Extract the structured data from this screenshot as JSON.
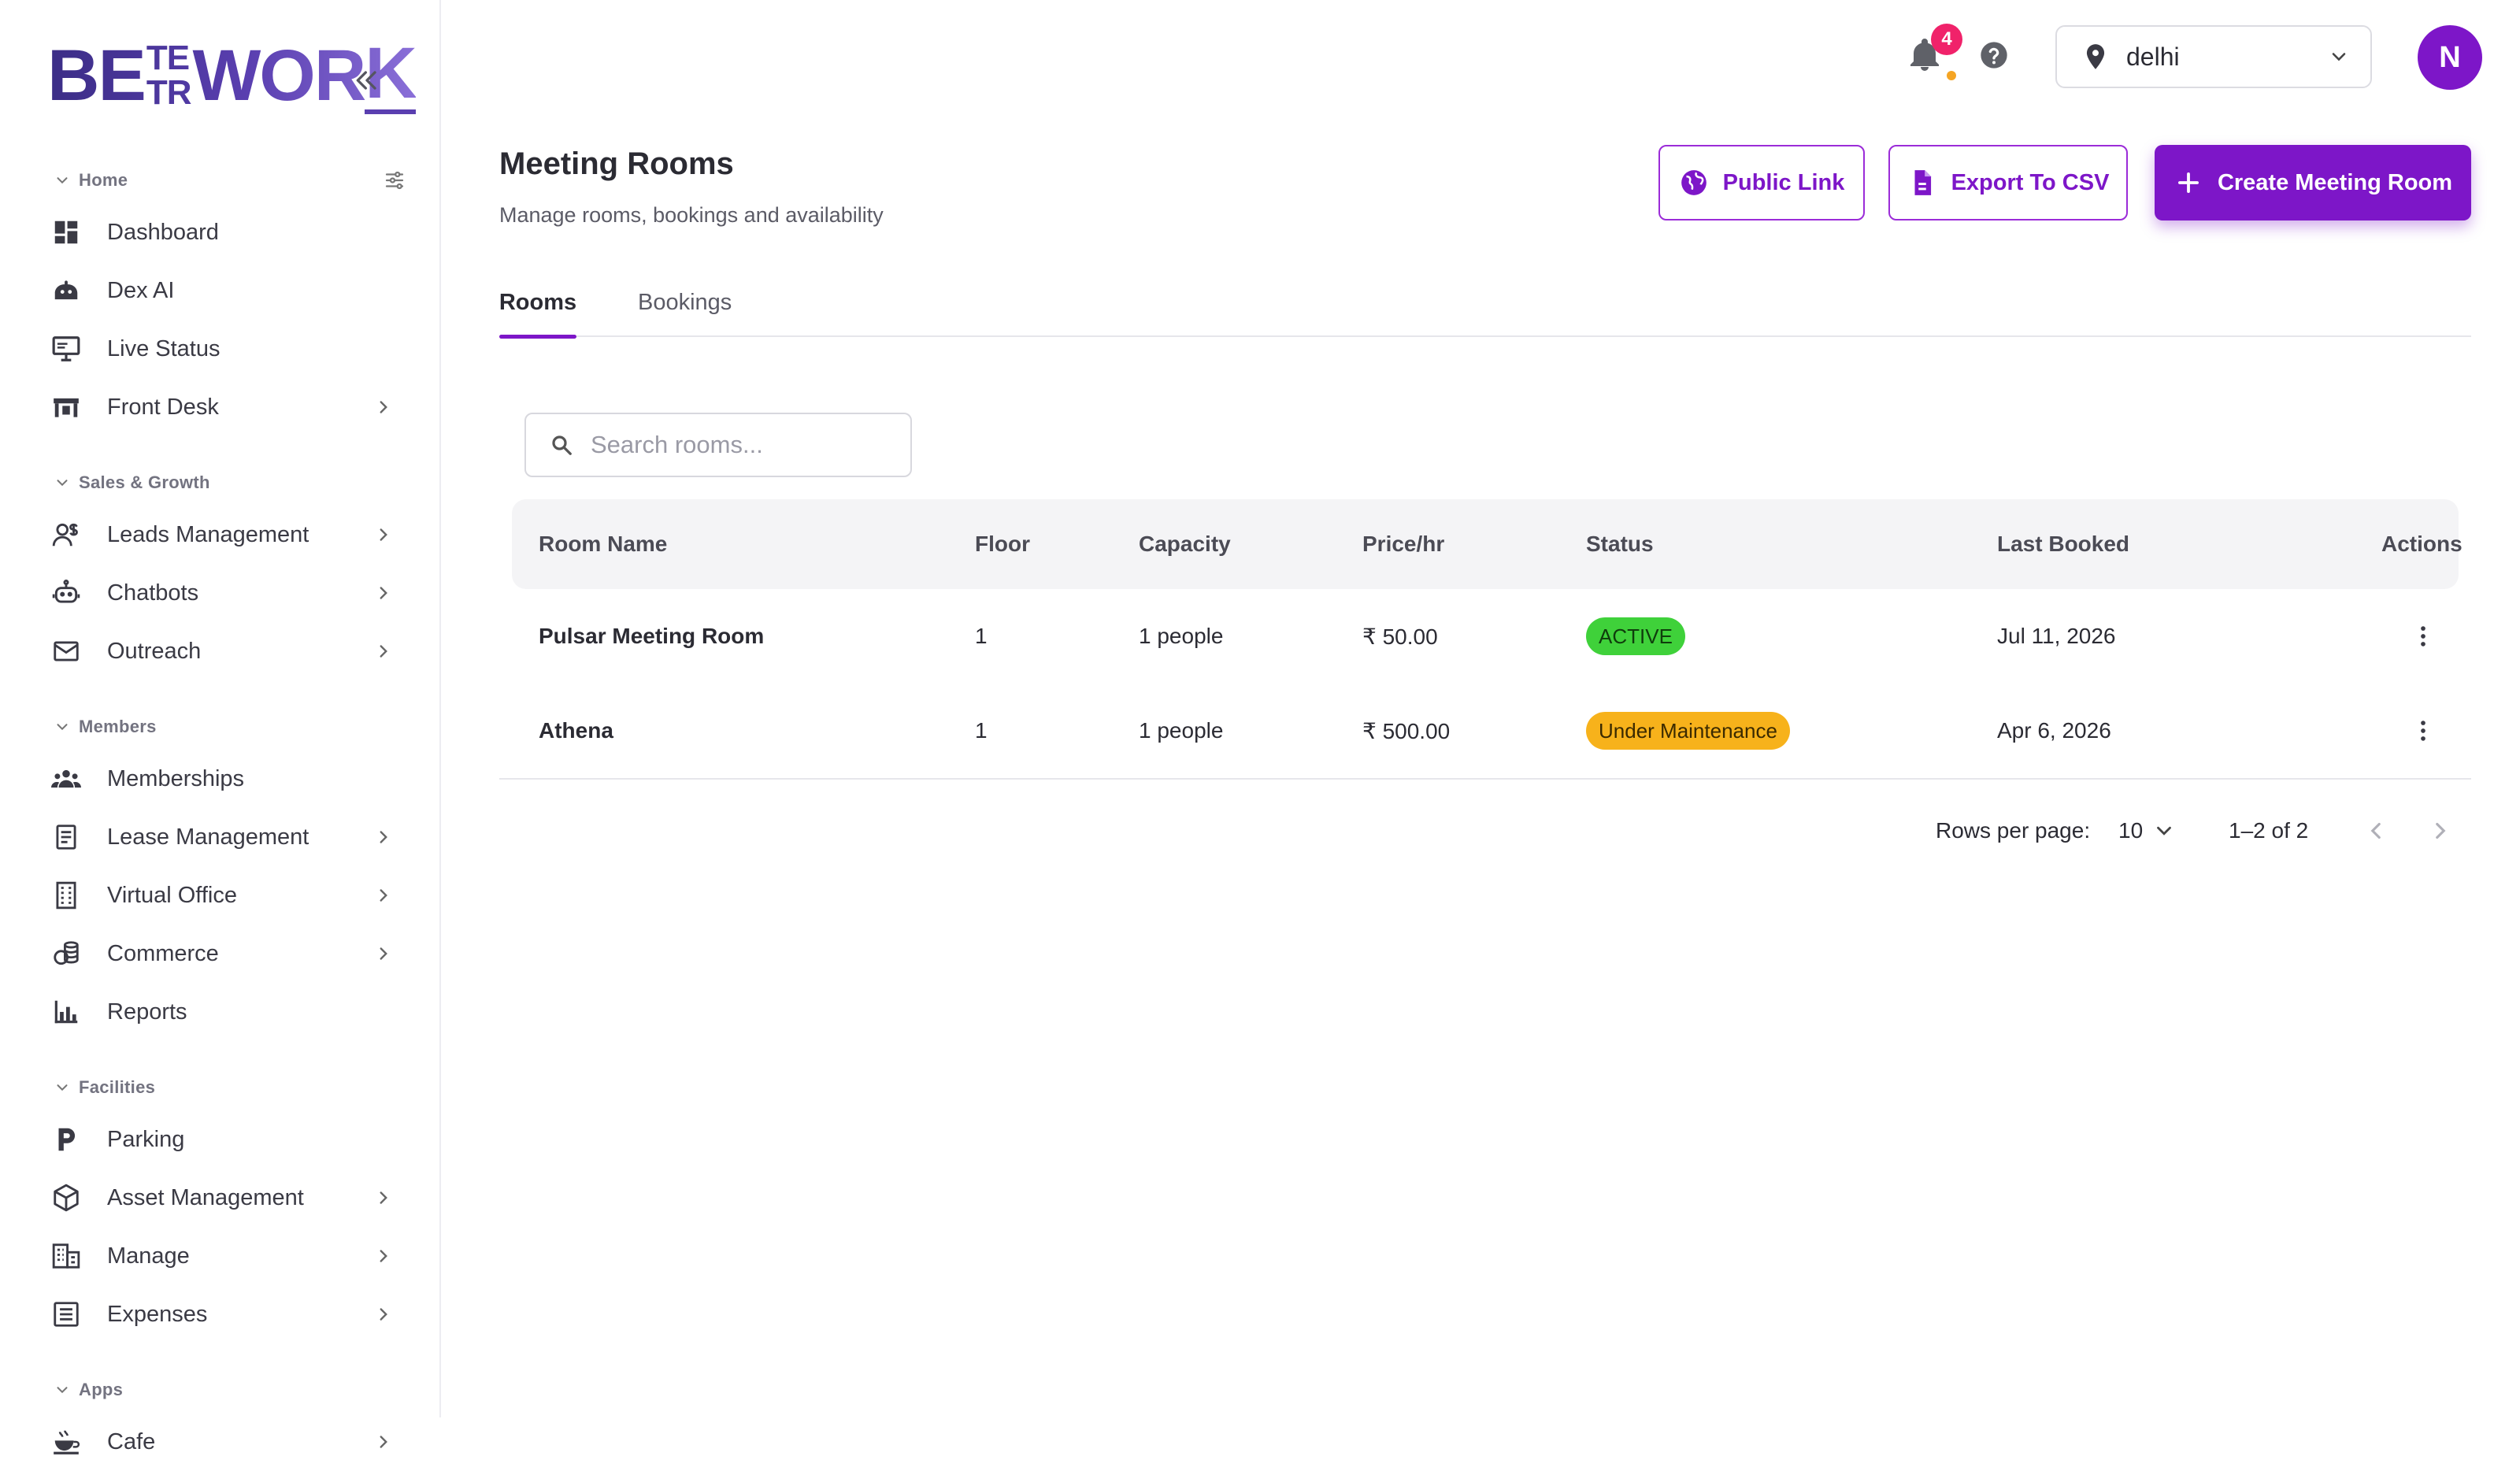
{
  "brand": {
    "logo_top": "BE",
    "logo_mid_a": "TE",
    "logo_mid_b": "TR",
    "logo_end": "WOR",
    "logo_last": "K"
  },
  "sidebar": {
    "sections": [
      {
        "title": "Home",
        "items": [
          {
            "label": "Dashboard",
            "icon": "dashboard-icon"
          },
          {
            "label": "Dex AI",
            "icon": "robot-icon"
          },
          {
            "label": "Live Status",
            "icon": "monitor-icon"
          },
          {
            "label": "Front Desk",
            "icon": "front-desk-icon",
            "has_children": true
          }
        ]
      },
      {
        "title": "Sales & Growth",
        "items": [
          {
            "label": "Leads Management",
            "icon": "leads-icon",
            "has_children": true
          },
          {
            "label": "Chatbots",
            "icon": "chatbot-icon",
            "has_children": true
          },
          {
            "label": "Outreach",
            "icon": "mail-icon",
            "has_children": true
          }
        ]
      },
      {
        "title": "Members",
        "items": [
          {
            "label": "Memberships",
            "icon": "people-icon"
          },
          {
            "label": "Lease Management",
            "icon": "lease-icon",
            "has_children": true
          },
          {
            "label": "Virtual Office",
            "icon": "building-icon",
            "has_children": true
          },
          {
            "label": "Commerce",
            "icon": "coins-icon",
            "has_children": true
          },
          {
            "label": "Reports",
            "icon": "reports-icon"
          }
        ]
      },
      {
        "title": "Facilities",
        "items": [
          {
            "label": "Parking",
            "icon": "parking-icon"
          },
          {
            "label": "Asset Management",
            "icon": "box-icon",
            "has_children": true
          },
          {
            "label": "Manage",
            "icon": "city-icon",
            "has_children": true
          },
          {
            "label": "Expenses",
            "icon": "list-icon",
            "has_children": true
          }
        ]
      },
      {
        "title": "Apps",
        "items": [
          {
            "label": "Cafe",
            "icon": "cafe-icon",
            "has_children": true
          }
        ]
      }
    ]
  },
  "topbar": {
    "notification_count": "4",
    "location": "delhi",
    "avatar_initial": "N"
  },
  "page": {
    "title": "Meeting Rooms",
    "subtitle": "Manage rooms, bookings and availability",
    "buttons": {
      "public_link": "Public Link",
      "export_csv": "Export To CSV",
      "create": "Create Meeting Room"
    },
    "tabs": [
      "Rooms",
      "Bookings"
    ],
    "active_tab": "Rooms"
  },
  "search": {
    "placeholder": "Search rooms..."
  },
  "table": {
    "columns": [
      "Room Name",
      "Floor",
      "Capacity",
      "Price/hr",
      "Status",
      "Last Booked",
      "Actions"
    ],
    "rows": [
      {
        "name": "Pulsar Meeting Room",
        "floor": "1",
        "capacity": "1 people",
        "price": "₹ 50.00",
        "status": "ACTIVE",
        "status_kind": "active",
        "last_booked": "Jul 11, 2026"
      },
      {
        "name": "Athena",
        "floor": "1",
        "capacity": "1 people",
        "price": "₹ 500.00",
        "status": "Under Maintenance",
        "status_kind": "maintenance",
        "last_booked": "Apr 6, 2026"
      }
    ]
  },
  "pagination": {
    "rows_per_page_label": "Rows per page:",
    "rows_per_page": "10",
    "range": "1–2 of 2"
  },
  "colors": {
    "accent": "#7d16c8",
    "active": "#3fd13a",
    "maintenance": "#f7b21b",
    "badge": "#f0226a"
  }
}
